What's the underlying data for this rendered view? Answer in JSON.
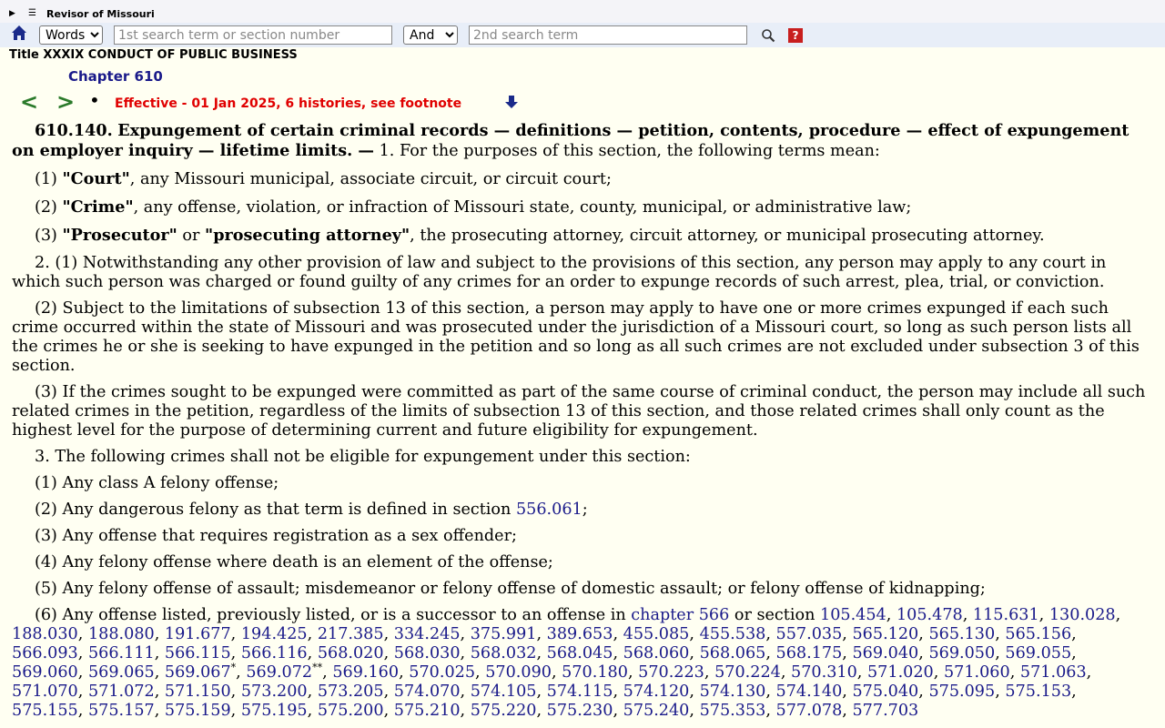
{
  "header": {
    "site_name": "Revisor of Missouri",
    "expand_icon": "triangle-right-icon",
    "menu_icon": "hamburger-icon"
  },
  "search": {
    "mode_selected": "Words",
    "term1_placeholder": "1st search term or section number",
    "operator_selected": "And",
    "term2_placeholder": "2nd search term",
    "help_label": "?"
  },
  "breadcrumb": {
    "title": "Title XXXIX CONDUCT OF PUBLIC BUSINESS",
    "chapter": "Chapter 610"
  },
  "nav": {
    "prev_label": "<",
    "next_label": ">",
    "dot_label": "•",
    "effective_text": "Effective - 01 Jan 2025, 6 histories, see footnote"
  },
  "section": {
    "number": "610.140.",
    "heading": "Expungement of certain criminal records — definitions — petition, contents, procedure — effect of expungement on employer inquiry — lifetime limits. —",
    "intro": " 1.  For the purposes of this section, the following terms mean:",
    "def1_num": "(1) ",
    "def1_term": "\"Court\"",
    "def1_text": ", any Missouri municipal, associate circuit, or circuit court;",
    "def2_num": "(2) ",
    "def2_term": "\"Crime\"",
    "def2_text": ", any offense, violation, or infraction of Missouri state, county, municipal, or administrative law;",
    "def3_num": "(3) ",
    "def3_term1": "\"Prosecutor\"",
    "def3_or": " or ",
    "def3_term2": "\"prosecuting attorney\"",
    "def3_text": ", the prosecuting attorney, circuit attorney, or municipal prosecuting attorney.",
    "p2_1": "2.  (1)  Notwithstanding any other provision of law and subject to the provisions of this section, any person may apply to any court in which such person was charged or found guilty of any crimes for an order to expunge records of such arrest, plea, trial, or conviction.",
    "p2_2": "(2)  Subject to the limitations of subsection 13 of this section, a person may apply to have one or more crimes expunged if each such crime occurred within the state of Missouri and was prosecuted under the jurisdiction of a Missouri court, so long as such person lists all the crimes he or she is seeking to have expunged in the petition and so long as all such crimes are not excluded under subsection 3 of this section.",
    "p2_3": "(3)  If the crimes sought to be expunged were committed as part of the same course of criminal conduct, the person may include all such related crimes in the petition, regardless of the limits of subsection 13 of this section, and those related crimes shall only count as the highest level for the purpose of determining current and future eligibility for expungement.",
    "p3": "3.  The following crimes shall not be eligible for expungement under this section:",
    "p3_1": "(1)  Any class A felony offense;",
    "p3_2_pre": "(2)  Any dangerous felony as that term is defined in section ",
    "p3_2_link": "556.061",
    "p3_2_post": ";",
    "p3_3": "(3)  Any offense that requires registration as a sex offender;",
    "p3_4": "(4)  Any felony offense where death is an element of the offense;",
    "p3_5": "(5)  Any felony offense of assault; misdemeanor or felony offense of domestic assault; or felony offense of kidnapping;",
    "p3_6_pre": "(6)  Any offense listed, previously listed, or is a successor to an offense in ",
    "p3_6_chapter": "chapter 566",
    "p3_6_mid": " or section ",
    "sections": [
      "105.454",
      "105.478",
      "115.631",
      "130.028",
      "188.030",
      "188.080",
      "191.677",
      "194.425",
      "217.385",
      "334.245",
      "375.991",
      "389.653",
      "455.085",
      "455.538",
      "557.035",
      "565.120",
      "565.130",
      "565.156",
      "566.093",
      "566.111",
      "566.115",
      "566.116",
      "568.020",
      "568.030",
      "568.032",
      "568.045",
      "568.060",
      "568.065",
      "568.175",
      "569.040",
      "569.050",
      "569.055",
      "569.060",
      "569.065",
      "569.067",
      "569.072",
      "569.160",
      "570.025",
      "570.090",
      "570.180",
      "570.223",
      "570.224",
      "570.310",
      "571.020",
      "571.060",
      "571.063",
      "571.070",
      "571.072",
      "571.150",
      "573.200",
      "573.205",
      "574.070",
      "574.105",
      "574.115",
      "574.120",
      "574.130",
      "574.140",
      "575.040",
      "575.095",
      "575.153",
      "575.155",
      "575.157",
      "575.159",
      "575.195",
      "575.200",
      "575.210",
      "575.220",
      "575.230",
      "575.240",
      "575.353",
      "577.078",
      "577.703"
    ],
    "footnote_single": "*",
    "footnote_double": "**"
  }
}
